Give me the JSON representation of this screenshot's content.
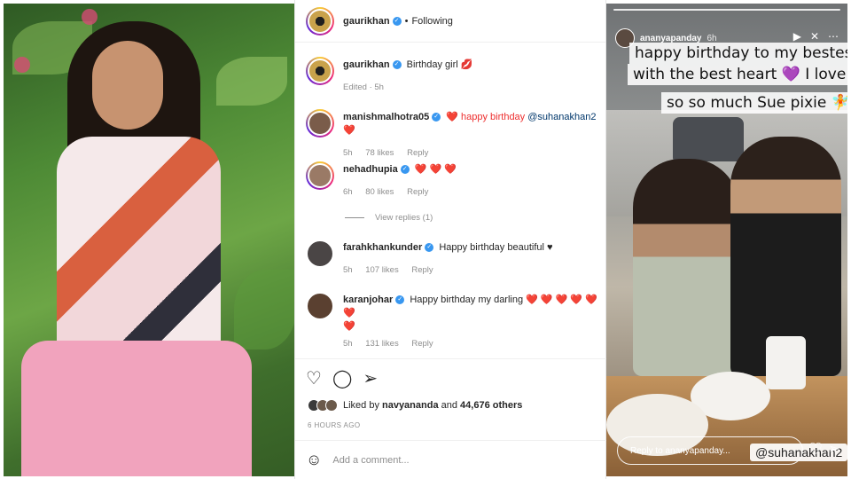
{
  "post": {
    "author": "gaurikhan",
    "header_status": "Following",
    "caption_user": "gaurikhan",
    "caption_text": "Birthday girl 💋",
    "caption_meta": "Edited · 5h",
    "comments": [
      {
        "user": "manishmalhotra05",
        "text": "❤️ happy birthday ",
        "mention": "@suhanakhan2",
        "trail": " ❤️",
        "time": "5h",
        "likes": "78 likes",
        "reply": "Reply"
      },
      {
        "user": "nehadhupia",
        "text": "❤️ ❤️ ❤️",
        "time": "6h",
        "likes": "80 likes",
        "reply": "Reply"
      },
      {
        "user": "farahkhankunder",
        "text": "Happy birthday beautiful ♥",
        "time": "5h",
        "likes": "107 likes",
        "reply": "Reply"
      },
      {
        "user": "karanjohar",
        "text": "Happy birthday my darling ❤️ ❤️ ❤️ ❤️ ❤️ ❤️",
        "trail": "❤️",
        "time": "5h",
        "likes": "131 likes",
        "reply": "Reply"
      }
    ],
    "view_replies": "View replies (1)",
    "liked_by_prefix": "Liked by ",
    "liked_by_user": "navyananda",
    "liked_by_and": " and ",
    "liked_by_count": "44,676 others",
    "time_ago": "6 HOURS AGO",
    "add_comment_placeholder": "Add a comment..."
  },
  "story": {
    "user": "ananyapanday",
    "time": "6h",
    "caption_line1": "happy birthday to my bestest gir",
    "caption_line2": "with the best heart 💜 I love u so",
    "caption_line3": "so so much Sue pixie 🧚",
    "reply_placeholder": "Reply to ananyapanday...",
    "mention_sticker": "@suhanakhan2"
  },
  "icons": {
    "heart": "heart-icon",
    "comment": "comment-icon",
    "share": "share-icon",
    "emoji": "emoji-icon"
  },
  "colors": {
    "verified": "#3897f0",
    "heart": "#ed2e2e",
    "muted": "#8e8e8e"
  }
}
